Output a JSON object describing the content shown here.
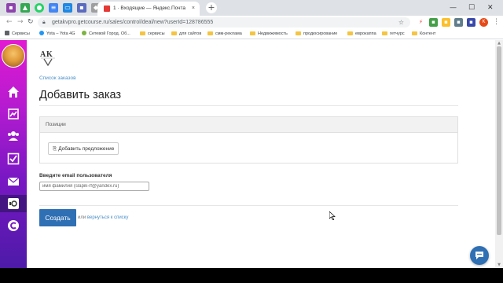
{
  "browser": {
    "active_tab_title": "1 · Входящие — Яндекс.Почта",
    "active_tab_close": "×",
    "new_tab": "+",
    "window_controls": {
      "minimize": "—",
      "maximize": "☐",
      "close": "✕"
    },
    "url": "getakvpro.getcourse.ru/sales/control/deal/new?userId=128786555",
    "profile_initial": "K",
    "bookmarks": [
      "Сервисы",
      "Yota – Yota 4G",
      "Сетевой Город. Об...",
      "сервисы",
      "для сайтов",
      "смм-реклама",
      "Недвижимость",
      "продюсирование",
      "еврокаппа",
      "гетчурс",
      "Контент"
    ]
  },
  "sidebar": {
    "items": [
      "home-icon",
      "chart-icon",
      "users-icon",
      "tasks-icon",
      "mail-icon",
      "getcourse-icon",
      "chat-logo-icon"
    ]
  },
  "page": {
    "breadcrumb": "Список заказов",
    "title": "Добавить заказ",
    "positions_header": "Позиции",
    "add_offer_label": "Добавить предложение",
    "email_label": "Введите email пользователя",
    "email_placeholder": "имя фамилия (slapik-rf@yandex.ru)",
    "create_button": "Создать",
    "or_text": "или ",
    "back_link": "вернуться к списку"
  },
  "colors": {
    "accent": "#2f6fb3",
    "link": "#4a8fc9",
    "sidebar_top": "#e21ad2",
    "sidebar_bottom": "#4d1aa8"
  }
}
